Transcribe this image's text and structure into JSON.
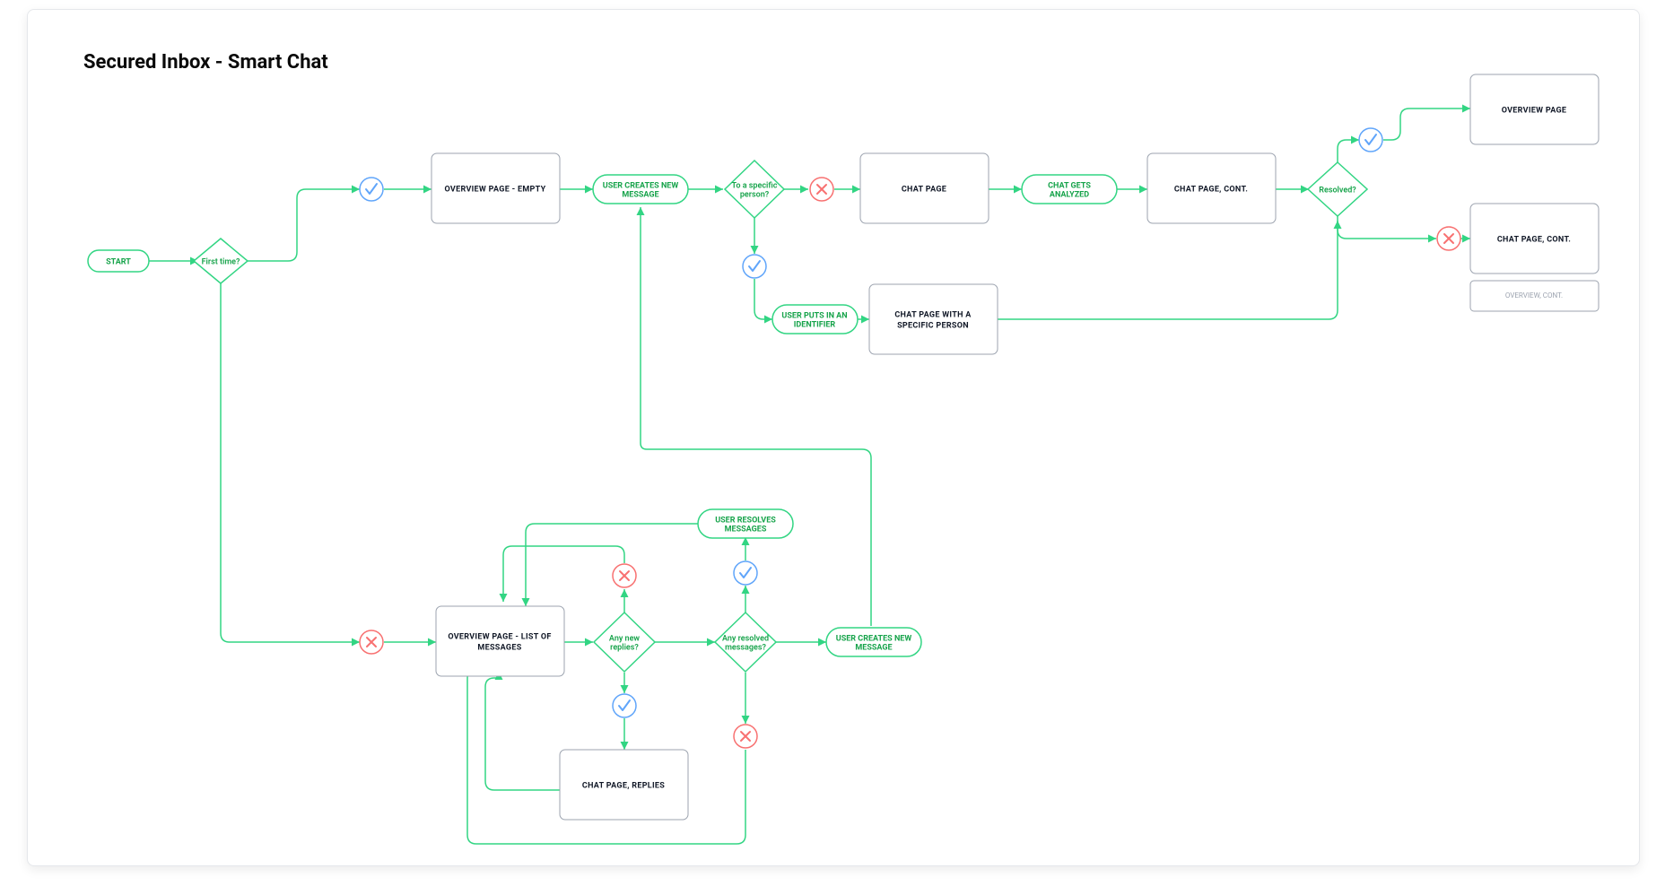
{
  "title": "Secured Inbox - Smart Chat",
  "labels": {
    "start": "START",
    "first_time": "First time?",
    "overview_empty": "OVERVIEW PAGE - EMPTY",
    "user_creates_new_message": "USER CREATES NEW MESSAGE",
    "to_specific_person": "To a specific person?",
    "chat_page": "CHAT PAGE",
    "chat_gets_analyzed": "CHAT GETS ANALYZED",
    "chat_page_cont": "CHAT PAGE, CONT.",
    "resolved_q": "Resolved?",
    "overview_page": "OVERVIEW PAGE",
    "chat_page_cont2": "CHAT PAGE, CONT.",
    "overview_cont": "OVERVIEW, CONT.",
    "user_puts_identifier": "USER PUTS IN AN IDENTIFIER",
    "chat_page_specific": "CHAT PAGE WITH A SPECIFIC PERSON",
    "overview_list": "OVERVIEW PAGE - LIST OF MESSAGES",
    "any_new_replies": "Any new replies?",
    "any_resolved": "Any resolved messages?",
    "user_resolves": "USER RESOLVES MESSAGES",
    "chat_page_replies": "CHAT PAGE, REPLIES",
    "user_creates_new_message_2": "USER CREATES NEW MESSAGE"
  }
}
